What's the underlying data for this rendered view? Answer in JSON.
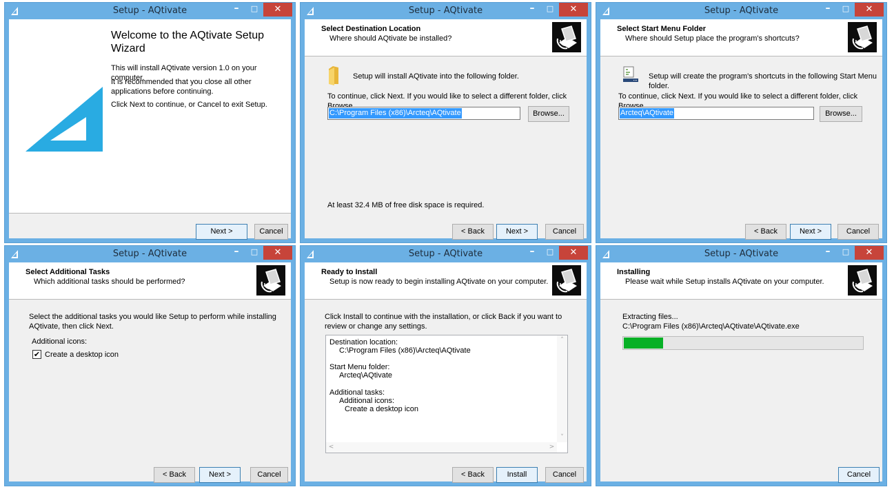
{
  "window_title": "Setup - AQtivate",
  "controls": {
    "minimize": "–",
    "maximize": "□",
    "close": "✕"
  },
  "colors": {
    "accent": "#29abe2",
    "title_bar": "#6bb0e4",
    "close": "#c7443a",
    "progress": "#06b025",
    "selection": "#3399ff"
  },
  "buttons": {
    "back": "< Back",
    "next": "Next >",
    "cancel": "Cancel",
    "install": "Install",
    "browse": "Browse..."
  },
  "welcome": {
    "title": "Welcome to the AQtivate Setup Wizard",
    "p1": "This will install AQtivate version 1.0 on your computer.",
    "p2": "It is recommended that you close all other applications before continuing.",
    "p3": "Click Next to continue, or Cancel to exit Setup.",
    "logo_icon": "aqtivate-logo-icon"
  },
  "destination": {
    "title": "Select Destination Location",
    "subtitle": "Where should AQtivate be installed?",
    "info": "Setup will install AQtivate into the following folder.",
    "instruction": "To continue, click Next. If you would like to select a different folder, click Browse.",
    "path_value": "C:\\Program Files (x86)\\Arcteq\\AQtivate",
    "disk_space": "At least 32.4 MB of free disk space is required.",
    "icon": "folder-icon"
  },
  "startmenu": {
    "title": "Select Start Menu Folder",
    "subtitle": "Where should Setup place the program's shortcuts?",
    "info": "Setup will create the program's shortcuts in the following Start Menu folder.",
    "instruction": "To continue, click Next. If you would like to select a different folder, click Browse.",
    "folder_value": "Arcteq\\AQtivate",
    "icon": "start-menu-folder-icon"
  },
  "tasks": {
    "title": "Select Additional Tasks",
    "subtitle": "Which additional tasks should be performed?",
    "instruction": "Select the additional tasks you would like Setup to perform while installing AQtivate, then click Next.",
    "group_label": "Additional icons:",
    "checkbox_label": "Create a desktop icon",
    "checkbox_mark": "✔",
    "checked": true
  },
  "ready": {
    "title": "Ready to Install",
    "subtitle": "Setup is now ready to begin installing AQtivate on your computer.",
    "instruction": "Click Install to continue with the installation, or click Back if you want to review or change any settings.",
    "memo": {
      "dest_label": "Destination location:",
      "dest_value": "C:\\Program Files (x86)\\Arcteq\\AQtivate",
      "sm_label": "Start Menu folder:",
      "sm_value": "Arcteq\\AQtivate",
      "tasks_label": "Additional tasks:",
      "tasks_group": "Additional icons:",
      "tasks_item": "Create a desktop icon"
    },
    "scroll_up": "˄",
    "scroll_down": "˅",
    "scroll_left": "<",
    "scroll_right": ">"
  },
  "installing": {
    "title": "Installing",
    "subtitle": "Please wait while Setup installs AQtivate on your computer.",
    "status": "Extracting files...",
    "file": "C:\\Program Files (x86)\\Arcteq\\AQtivate\\AQtivate.exe",
    "progress": 0.17
  }
}
